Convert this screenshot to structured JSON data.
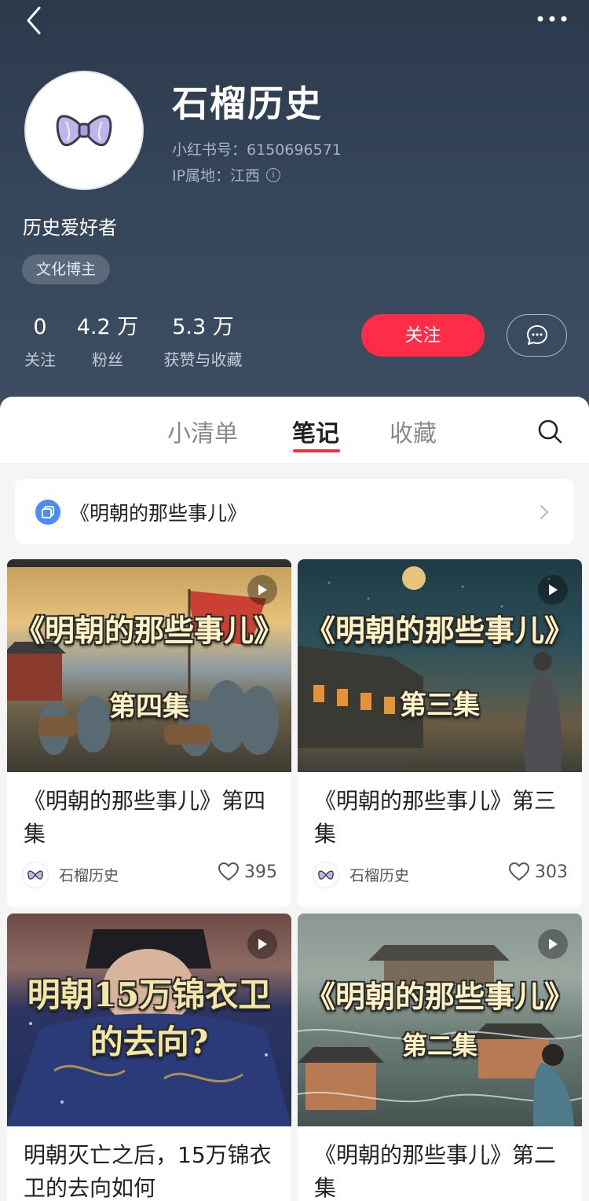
{
  "profile": {
    "nickname": "石榴历史",
    "id_text": "小红书号：6150696571",
    "ip_text": "IP属地：江西",
    "bio": "历史爱好者",
    "tag": "文化博主",
    "stats": [
      {
        "num": "0",
        "label": "关注"
      },
      {
        "num": "4.2 万",
        "label": "粉丝"
      },
      {
        "num": "5.3 万",
        "label": "获赞与收藏"
      }
    ],
    "follow_label": "关注"
  },
  "tabs": [
    {
      "label": "小清单",
      "active": false
    },
    {
      "label": "笔记",
      "active": true
    },
    {
      "label": "收藏",
      "active": false
    }
  ],
  "collection": {
    "label": "《明朝的那些事儿》"
  },
  "cards": [
    {
      "overlay_main": "《明朝的那些事儿》",
      "overlay_sub": "第四集",
      "title": "《明朝的那些事儿》第四集",
      "author": "石榴历史",
      "likes": "395"
    },
    {
      "overlay_main": "《明朝的那些事儿》",
      "overlay_sub": "第三集",
      "title": "《明朝的那些事儿》第三集",
      "author": "石榴历史",
      "likes": "303"
    },
    {
      "overlay_main": "明朝15万锦衣卫",
      "overlay_sub": "的去向?",
      "title": "明朝灭亡之后，15万锦衣卫的去向如何",
      "author": "",
      "likes": ""
    },
    {
      "overlay_main": "《明朝的那些事儿》",
      "overlay_sub": "第二集",
      "title": "《明朝的那些事儿》第二集",
      "author": "",
      "likes": ""
    }
  ],
  "colors": {
    "accent": "#fe2c47",
    "header_bg": "#2f3d50",
    "collection_icon": "#4b8df8"
  },
  "icons": [
    "back-icon",
    "more-icon",
    "info-icon",
    "chat-icon",
    "search-icon",
    "collection-icon",
    "chevron-right-icon",
    "play-icon",
    "heart-icon",
    "bow-avatar-icon"
  ]
}
